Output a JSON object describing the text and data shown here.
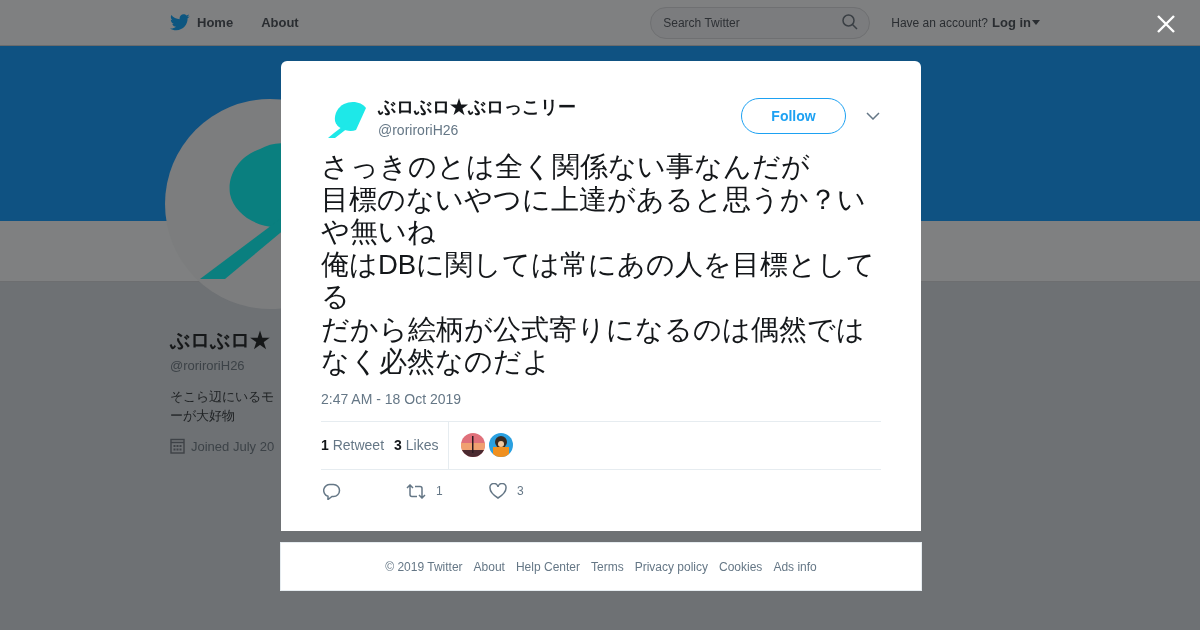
{
  "nav": {
    "links": [
      "Home",
      "About"
    ],
    "search": {
      "placeholder": "Search Twitter"
    },
    "account_prompt": "Have an account?",
    "login": "Log in"
  },
  "profile": {
    "name": "ぶロぶロ★",
    "handle": "@roriroriH26",
    "bio_lines": [
      "そこら辺にいるモ",
      "ーが大好物"
    ],
    "joined": "Joined July 20"
  },
  "tweet": {
    "name": "ぶロぶロ★ぶロっこリー",
    "handle": "@roriroriH26",
    "follow": "Follow",
    "text_lines": [
      "さっきのとは全く関係ない事なんだが",
      "目標のないやつに上達があると思うか？いや無いね",
      "俺はDBに関しては常にあの人を目標としてる",
      "だから絵柄が公式寄りになるのは偶然ではなく必然なのだよ"
    ],
    "time": "2:47 AM - 18 Oct 2019",
    "stats": [
      {
        "count": "1",
        "label": "Retweet"
      },
      {
        "count": "3",
        "label": "Likes"
      }
    ],
    "actions": [
      {
        "kind": "reply"
      },
      {
        "kind": "retweet",
        "count": "1"
      },
      {
        "kind": "like",
        "count": "3"
      }
    ]
  },
  "footer": [
    "© 2019 Twitter",
    "About",
    "Help Center",
    "Terms",
    "Privacy policy",
    "Cookies",
    "Ads info"
  ]
}
